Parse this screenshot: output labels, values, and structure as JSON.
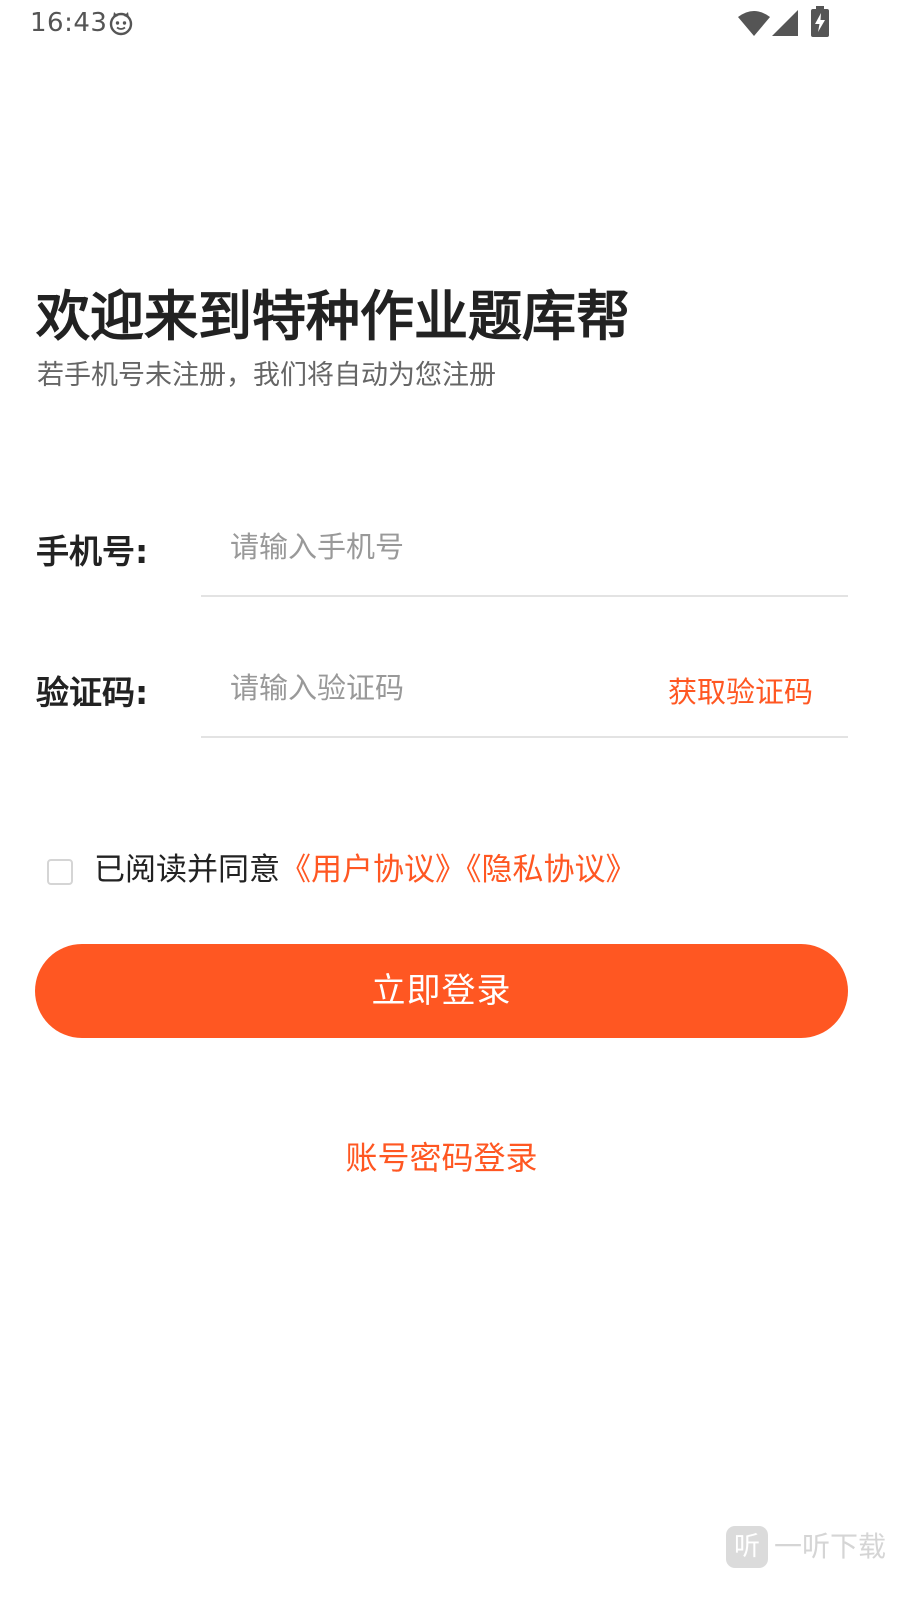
{
  "status_bar": {
    "time": "16:43",
    "icons": [
      "cat-face-icon",
      "wifi-icon",
      "signal-icon",
      "battery-charging-icon"
    ]
  },
  "header": {
    "title": "欢迎来到特种作业题库帮",
    "subtitle": "若手机号未注册，我们将自动为您注册"
  },
  "form": {
    "phone_label": "手机号:",
    "phone_placeholder": "请输入手机号",
    "phone_value": "",
    "code_label": "验证码:",
    "code_placeholder": "请输入验证码",
    "code_value": "",
    "get_code_label": "获取验证码"
  },
  "agreement": {
    "checked": false,
    "prefix": "已阅读并同意",
    "user_agreement": "《用户协议》",
    "privacy_policy": "《隐私协议》"
  },
  "actions": {
    "login_label": "立即登录",
    "alt_login_label": "账号密码登录"
  },
  "watermark": {
    "logo": "听",
    "text": "一听下载"
  },
  "colors": {
    "accent": "#ff5722",
    "title": "#222222",
    "subtitle": "#666666",
    "placeholder": "#999999",
    "divider": "#e3e3e3"
  }
}
